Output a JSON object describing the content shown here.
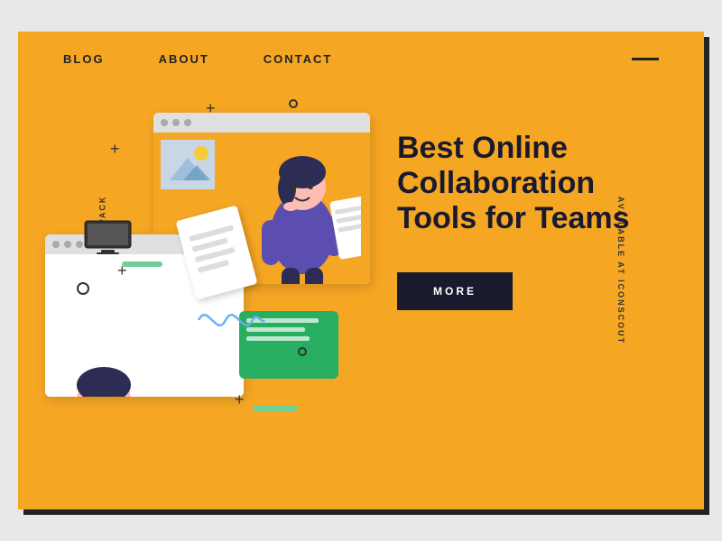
{
  "page": {
    "background_color": "#F5A623",
    "shadow_color": "#222222"
  },
  "side_labels": {
    "left": "WORK & WEB LOTTIE PACK",
    "right": "AVAILABLE AT ICONSCOUT"
  },
  "nav": {
    "items": [
      "BLOG",
      "ABOUT",
      "CONTACT"
    ],
    "menu_icon": "menu-dash"
  },
  "hero": {
    "title": "Best Online Collaboration Tools for Teams",
    "cta_label": "MORE"
  },
  "decorations": {
    "plus_signs": [
      "+",
      "+",
      "+"
    ],
    "accent_color": "#6FCF97",
    "green_color": "#27AE60"
  }
}
